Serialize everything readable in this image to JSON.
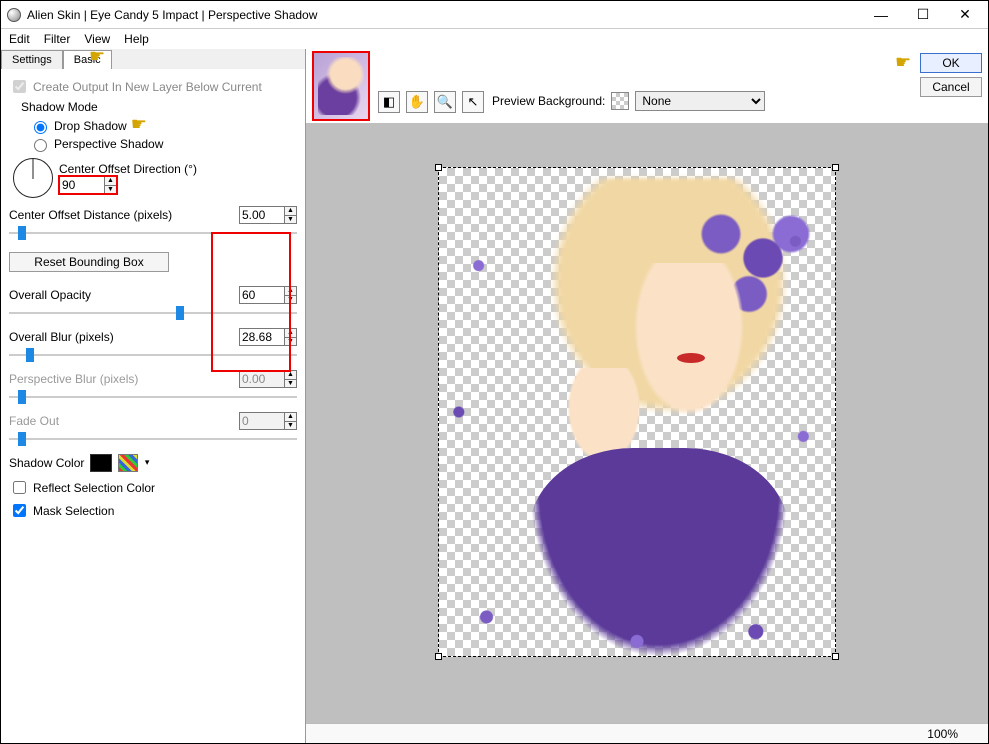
{
  "window": {
    "title": "Alien Skin | Eye Candy 5 Impact | Perspective Shadow",
    "min": "—",
    "max": "☐",
    "close": "✕"
  },
  "menu": {
    "edit": "Edit",
    "filter": "Filter",
    "view": "View",
    "help": "Help"
  },
  "tabs": {
    "settings": "Settings",
    "basic": "Basic"
  },
  "panel": {
    "create_output": "Create Output In New Layer Below Current",
    "shadow_mode": "Shadow Mode",
    "drop_shadow": "Drop Shadow",
    "perspective_shadow": "Perspective Shadow",
    "center_offset_dir_label": "Center Offset Direction (°)",
    "center_offset_dir_value": "90",
    "center_offset_dist_label": "Center Offset Distance (pixels)",
    "center_offset_dist_value": "5.00",
    "reset_btn": "Reset Bounding Box",
    "overall_opacity_label": "Overall Opacity",
    "overall_opacity_value": "60",
    "overall_blur_label": "Overall Blur (pixels)",
    "overall_blur_value": "28.68",
    "perspective_blur_label": "Perspective Blur (pixels)",
    "perspective_blur_value": "0.00",
    "fade_out_label": "Fade Out",
    "fade_out_value": "0",
    "shadow_color_label": "Shadow Color",
    "reflect_label": "Reflect Selection Color",
    "mask_label": "Mask Selection",
    "shadow_color_value": "#000000"
  },
  "preview": {
    "bg_label": "Preview Background:",
    "bg_value": "None"
  },
  "buttons": {
    "ok": "OK",
    "cancel": "Cancel"
  },
  "status": {
    "zoom": "100%"
  }
}
